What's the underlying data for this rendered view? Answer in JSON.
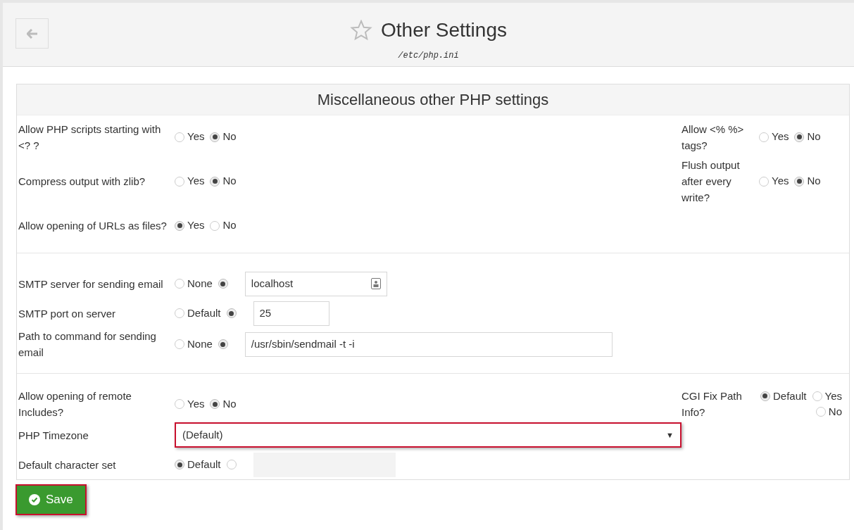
{
  "header": {
    "title": "Other Settings",
    "subtitle": "/etc/php.ini"
  },
  "panel": {
    "title": "Miscellaneous other PHP settings",
    "sections": [
      {
        "rows": [
          {
            "kind": "radios",
            "label": "Allow PHP scripts starting with <? ?",
            "options": [
              {
                "label": "Yes",
                "selected": false
              },
              {
                "label": "No",
                "selected": true
              }
            ],
            "right": {
              "label": "Allow <% %> tags?",
              "options": [
                {
                  "label": "Yes",
                  "selected": false
                },
                {
                  "label": "No",
                  "selected": true
                }
              ]
            }
          },
          {
            "kind": "radios",
            "label": "Compress output with zlib?",
            "options": [
              {
                "label": "Yes",
                "selected": false
              },
              {
                "label": "No",
                "selected": true
              }
            ],
            "right": {
              "label": "Flush output after every write?",
              "options": [
                {
                  "label": "Yes",
                  "selected": false
                },
                {
                  "label": "No",
                  "selected": true
                }
              ]
            }
          },
          {
            "kind": "radios",
            "label": "Allow opening of URLs as files?",
            "options": [
              {
                "label": "Yes",
                "selected": true
              },
              {
                "label": "No",
                "selected": false
              }
            ]
          }
        ]
      },
      {
        "rows": [
          {
            "kind": "radios_field",
            "label": "SMTP server for sending email",
            "options": [
              {
                "label": "None",
                "selected": false
              },
              {
                "selected": true
              }
            ],
            "field": {
              "kind": "medium",
              "value": "localhost",
              "disabled": false,
              "lookup": true
            }
          },
          {
            "kind": "radios_field",
            "label": "SMTP port on server",
            "options": [
              {
                "label": "Default",
                "selected": false
              },
              {
                "selected": true
              }
            ],
            "field": {
              "kind": "short",
              "value": "25",
              "disabled": false,
              "lookup": false
            }
          },
          {
            "kind": "radios_field",
            "label": "Path to command for sending email",
            "options": [
              {
                "label": "None",
                "selected": false
              },
              {
                "selected": true
              }
            ],
            "field": {
              "kind": "long",
              "value": "/usr/sbin/sendmail -t -i",
              "disabled": false,
              "lookup": false
            }
          }
        ]
      },
      {
        "rows": [
          {
            "kind": "radios",
            "label": "Allow opening of remote Includes?",
            "options": [
              {
                "label": "Yes",
                "selected": false
              },
              {
                "label": "No",
                "selected": true
              }
            ],
            "right": {
              "label": "CGI Fix Path Info?",
              "options": [
                {
                  "label": "Default",
                  "selected": true
                },
                {
                  "label": "Yes",
                  "selected": false
                },
                {
                  "label": "No",
                  "selected": false
                }
              ]
            }
          },
          {
            "kind": "select",
            "label": "PHP Timezone",
            "value": "(Default)",
            "caret": "▼"
          },
          {
            "kind": "radios_field",
            "label": "Default character set",
            "options": [
              {
                "label": "Default",
                "selected": true
              },
              {
                "selected": false
              }
            ],
            "field": {
              "kind": "medium",
              "disabled": true,
              "lookup": false
            }
          }
        ]
      }
    ]
  },
  "save_button": {
    "label": "Save"
  }
}
